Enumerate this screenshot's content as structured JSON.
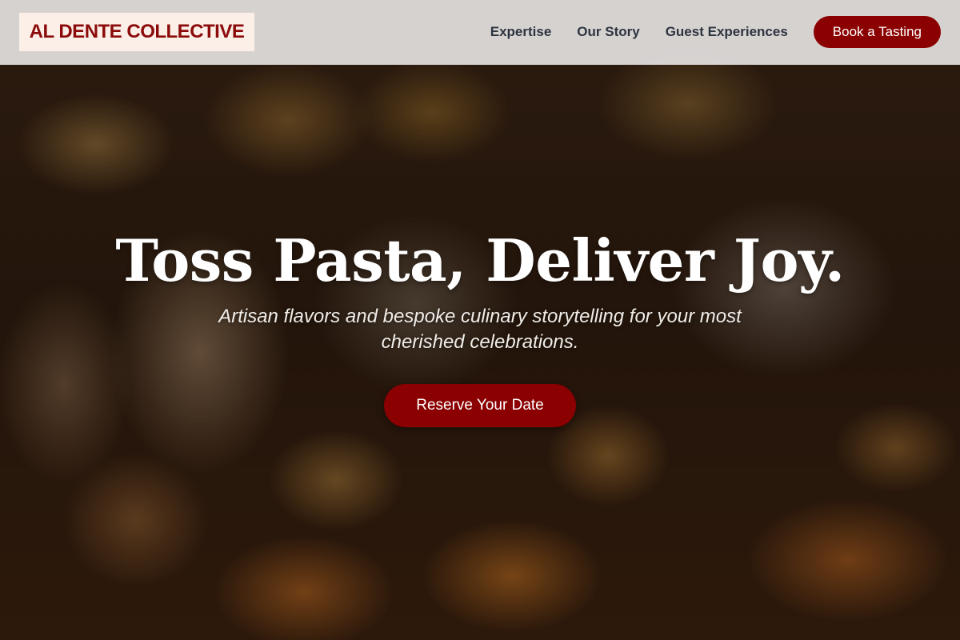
{
  "brand": {
    "name": "AL DENTE COLLECTIVE",
    "color": "#8b0a0a"
  },
  "nav": {
    "links": [
      "Expertise",
      "Our Story",
      "Guest Experiences"
    ],
    "cta_label": "Book a Tasting"
  },
  "hero": {
    "title": "Toss Pasta, Deliver Joy.",
    "subtitle": "Artisan flavors and bespoke culinary storytelling for your most cherished celebrations.",
    "cta_label": "Reserve Your Date",
    "background": "food-photo"
  },
  "colors": {
    "accent": "#8b0000",
    "header_bg": "#eeecec",
    "nav_text": "#2c3440"
  }
}
